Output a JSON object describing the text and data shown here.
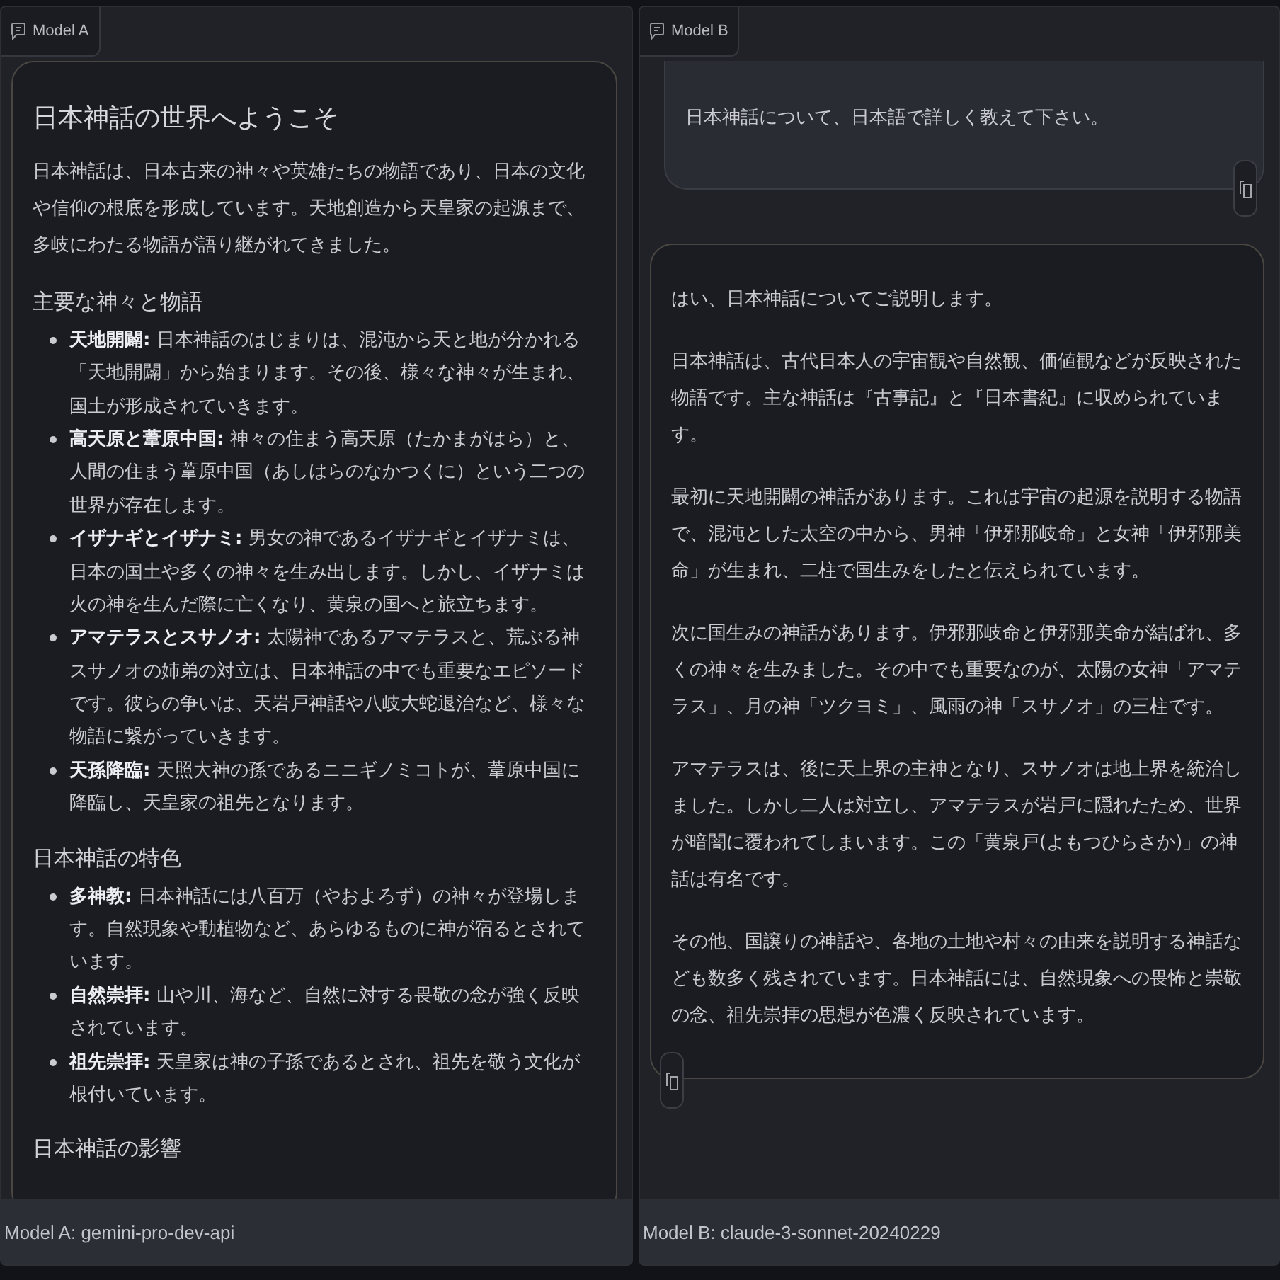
{
  "panels": [
    {
      "label": "Model A",
      "messages": [
        {
          "kind": "assistant",
          "copy_button": false,
          "blocks": [
            {
              "kind": "heading",
              "text": "日本神話の世界へようこそ"
            },
            {
              "kind": "paragraph",
              "text": "日本神話は、日本古来の神々や英雄たちの物語であり、日本の文化や信仰の根底を形成しています。天地創造から天皇家の起源まで、多岐にわたる物語が語り継がれてきました。"
            },
            {
              "kind": "subheading",
              "text": "主要な神々と物語"
            },
            {
              "kind": "list",
              "items": [
                "**天地開闢:** 日本神話のはじまりは、混沌から天と地が分かれる「天地開闢」から始まります。その後、様々な神々が生まれ、国土が形成されていきます。",
                "**高天原と葦原中国:** 神々の住まう高天原（たかまがはら）と、人間の住まう葦原中国（あしはらのなかつくに）という二つの世界が存在します。",
                "**イザナギとイザナミ:** 男女の神であるイザナギとイザナミは、日本の国土や多くの神々を生み出します。しかし、イザナミは火の神を生んだ際に亡くなり、黄泉の国へと旅立ちます。",
                "**アマテラスとスサノオ:** 太陽神であるアマテラスと、荒ぶる神スサノオの姉弟の対立は、日本神話の中でも重要なエピソードです。彼らの争いは、天岩戸神話や八岐大蛇退治など、様々な物語に繋がっていきます。",
                "**天孫降臨:** 天照大神の孫であるニニギノミコトが、葦原中国に降臨し、天皇家の祖先となります。"
              ]
            },
            {
              "kind": "subheading",
              "text": "日本神話の特色"
            },
            {
              "kind": "list",
              "items": [
                "**多神教:** 日本神話には八百万（やおよろず）の神々が登場します。自然現象や動植物など、あらゆるものに神が宿るとされています。",
                "**自然崇拝:** 山や川、海など、自然に対する畏敬の念が強く反映されています。",
                "**祖先崇拝:** 天皇家は神の子孫であるとされ、祖先を敬う文化が根付いています。"
              ]
            },
            {
              "kind": "subheading",
              "text": "日本神話の影響"
            }
          ]
        }
      ],
      "footer": "Model A: gemini-pro-dev-api"
    },
    {
      "label": "Model B",
      "messages": [
        {
          "kind": "user",
          "copy_button": true,
          "blocks": [
            {
              "kind": "paragraph",
              "text": "日本神話について、日本語で詳しく教えて下さい。"
            }
          ]
        },
        {
          "kind": "assistant",
          "copy_button": true,
          "blocks": [
            {
              "kind": "paragraph",
              "text": "はい、日本神話についてご説明します。"
            },
            {
              "kind": "paragraph",
              "text": "日本神話は、古代日本人の宇宙観や自然観、価値観などが反映された物語です。主な神話は『古事記』と『日本書紀』に収められています。"
            },
            {
              "kind": "paragraph",
              "text": "最初に天地開闢の神話があります。これは宇宙の起源を説明する物語で、混沌とした太空の中から、男神「伊邪那岐命」と女神「伊邪那美命」が生まれ、二柱で国生みをしたと伝えられています。"
            },
            {
              "kind": "paragraph",
              "text": "次に国生みの神話があります。伊邪那岐命と伊邪那美命が結ばれ、多くの神々を生みました。その中でも重要なのが、太陽の女神「アマテラス」、月の神「ツクヨミ」、風雨の神「スサノオ」の三柱です。"
            },
            {
              "kind": "paragraph",
              "text": "アマテラスは、後に天上界の主神となり、スサノオは地上界を統治しました。しかし二人は対立し、アマテラスが岩戸に隠れたため、世界が暗闇に覆われてしまいます。この「黄泉戸(よもつひらさか)」の神話は有名です。"
            },
            {
              "kind": "paragraph",
              "text": "その他、国譲りの神話や、各地の土地や村々の由来を説明する神話なども数多く残されています。日本神話には、自然現象への畏怖と崇敬の念、祖先崇拝の思想が色濃く反映されています。"
            }
          ]
        }
      ],
      "footer": "Model B: claude-3-sonnet-20240229"
    }
  ]
}
